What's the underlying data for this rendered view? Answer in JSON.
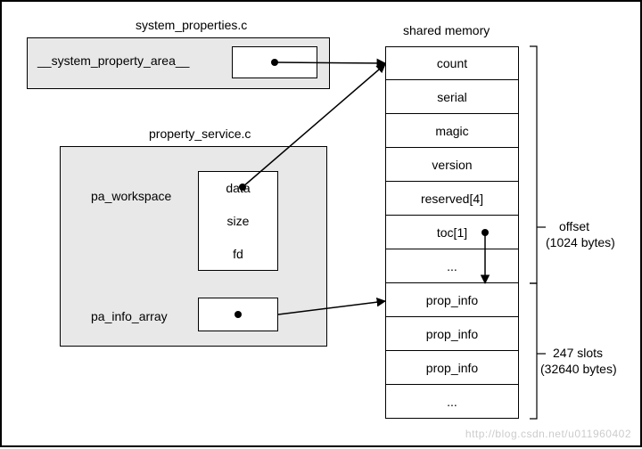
{
  "mod1": {
    "title": "system_properties.c",
    "var": "__system_property_area__"
  },
  "mod2": {
    "title": "property_service.c",
    "struct_label": "pa_workspace",
    "fields": {
      "data": "data",
      "size": "size",
      "fd": "fd"
    },
    "array_label": "pa_info_array"
  },
  "shared": {
    "title": "shared memory",
    "cells": {
      "count": "count",
      "serial": "serial",
      "magic": "magic",
      "version": "version",
      "reserved": "reserved[4]",
      "toc": "toc[1]",
      "dots1": "...",
      "prop1": "prop_info",
      "prop2": "prop_info",
      "prop3": "prop_info",
      "dots2": "..."
    },
    "annot1a": "offset",
    "annot1b": "(1024 bytes)",
    "annot2a": "247 slots",
    "annot2b": "(32640 bytes)"
  },
  "watermark": "http://blog.csdn.net/u011960402"
}
